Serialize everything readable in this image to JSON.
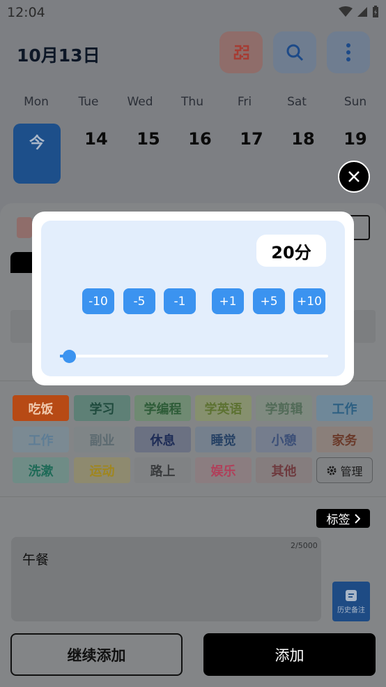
{
  "status_bar": {
    "time": "12:04"
  },
  "header": {
    "date": "10月13日"
  },
  "week": {
    "days": [
      "Mon",
      "Tue",
      "Wed",
      "Thu",
      "Fri",
      "Sat",
      "Sun"
    ],
    "today_label": "今",
    "dates": [
      "14",
      "15",
      "16",
      "17",
      "18",
      "19"
    ]
  },
  "modal": {
    "duration": "20分",
    "steps": [
      "-10",
      "-5",
      "-1",
      "+1",
      "+5",
      "+10"
    ],
    "slider_fraction": 0.03
  },
  "tags": {
    "row1": [
      "吃饭",
      "学习",
      "学编程",
      "学英语",
      "学剪辑",
      "工作"
    ],
    "row2": [
      "工作",
      "副业",
      "休息",
      "睡觉",
      "小憩",
      "家务"
    ],
    "row3": [
      "洗漱",
      "运动",
      "路上",
      "娱乐",
      "其他"
    ],
    "manage": "管理"
  },
  "labels_button": "标签",
  "note": {
    "text": "午餐",
    "counter": "2/5000",
    "history": "历史备注"
  },
  "actions": {
    "continue": "继续添加",
    "add": "添加"
  },
  "colors": {
    "accent": "#3b93f0",
    "today": "#1d4f8a"
  }
}
